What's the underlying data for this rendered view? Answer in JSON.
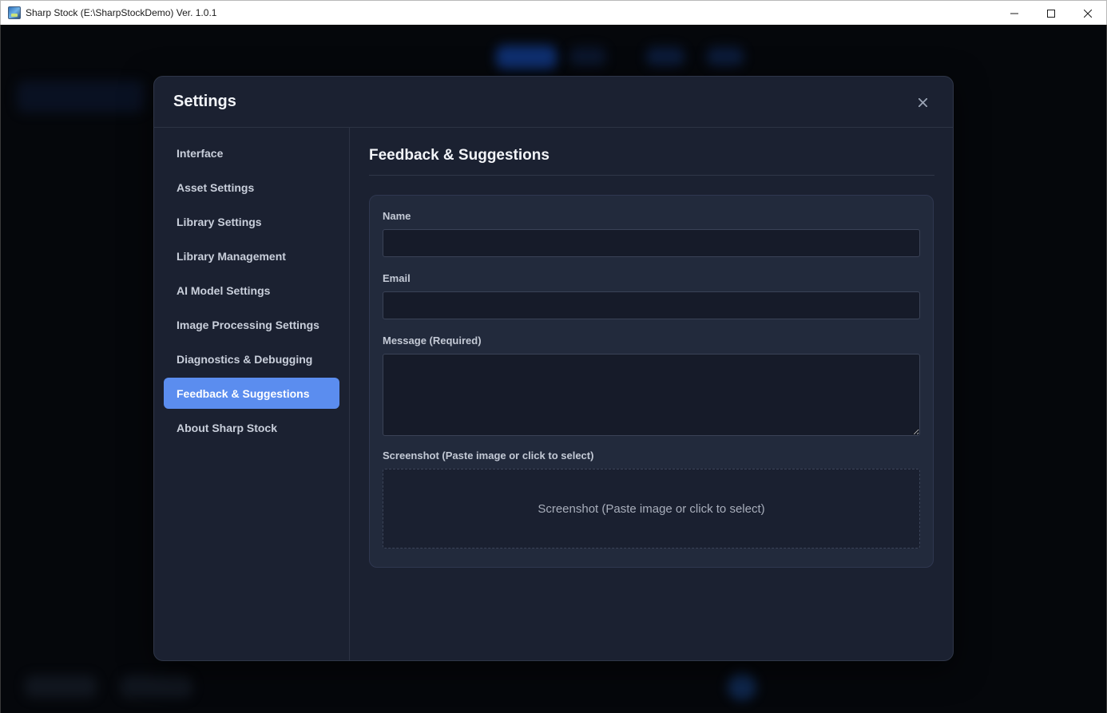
{
  "window": {
    "title": "Sharp Stock (E:\\SharpStockDemo) Ver. 1.0.1"
  },
  "modal": {
    "title": "Settings"
  },
  "sidebar": {
    "items": [
      {
        "label": "Interface"
      },
      {
        "label": "Asset Settings"
      },
      {
        "label": "Library Settings"
      },
      {
        "label": "Library Management"
      },
      {
        "label": "AI Model Settings"
      },
      {
        "label": "Image Processing Settings"
      },
      {
        "label": "Diagnostics & Debugging"
      },
      {
        "label": "Feedback & Suggestions",
        "active": true
      },
      {
        "label": "About Sharp Stock"
      }
    ]
  },
  "content": {
    "title": "Feedback & Suggestions",
    "form": {
      "name_label": "Name",
      "name_value": "",
      "email_label": "Email",
      "email_value": "",
      "message_label": "Message (Required)",
      "message_value": "",
      "screenshot_label": "Screenshot (Paste image or click to select)",
      "screenshot_placeholder": "Screenshot (Paste image or click to select)"
    }
  },
  "colors": {
    "accent": "#5b8def",
    "modal_bg": "#1b2131",
    "card_bg": "#222a3c",
    "app_bg": "#05070b"
  },
  "icons": {
    "app": "app-icon",
    "minimize": "minimize-icon",
    "maximize": "maximize-icon",
    "window_close": "close-icon",
    "modal_close": "close-icon"
  }
}
